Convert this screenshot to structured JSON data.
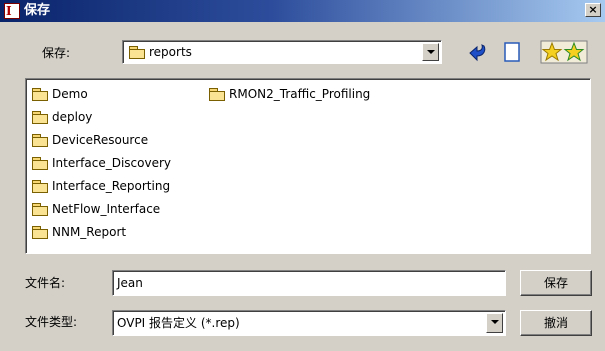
{
  "window": {
    "title": "保存",
    "close_glyph": "×",
    "app_icon_glyph": "I"
  },
  "location": {
    "label": "保存:",
    "value": "reports"
  },
  "toolbar": {
    "icons": [
      "back-arrow-icon",
      "new-document-icon",
      "favorites-icon"
    ]
  },
  "files": {
    "column1": [
      "Demo",
      "deploy",
      "DeviceResource",
      "Interface_Discovery",
      "Interface_Reporting",
      "NetFlow_Interface",
      "NNM_Report"
    ],
    "column2": [
      "RMON2_Traffic_Profiling"
    ]
  },
  "filename": {
    "label": "文件名:",
    "value": "Jean"
  },
  "filetype": {
    "label": "文件类型:",
    "value": "OVPI 报告定义 (*.rep)"
  },
  "buttons": {
    "save_label": "保存",
    "cancel_label": "撤消"
  },
  "colors": {
    "titlebar_start": "#0a246a",
    "titlebar_end": "#a6caf0",
    "dialog_bg": "#d4d0c8",
    "folder": "#fbe394"
  }
}
